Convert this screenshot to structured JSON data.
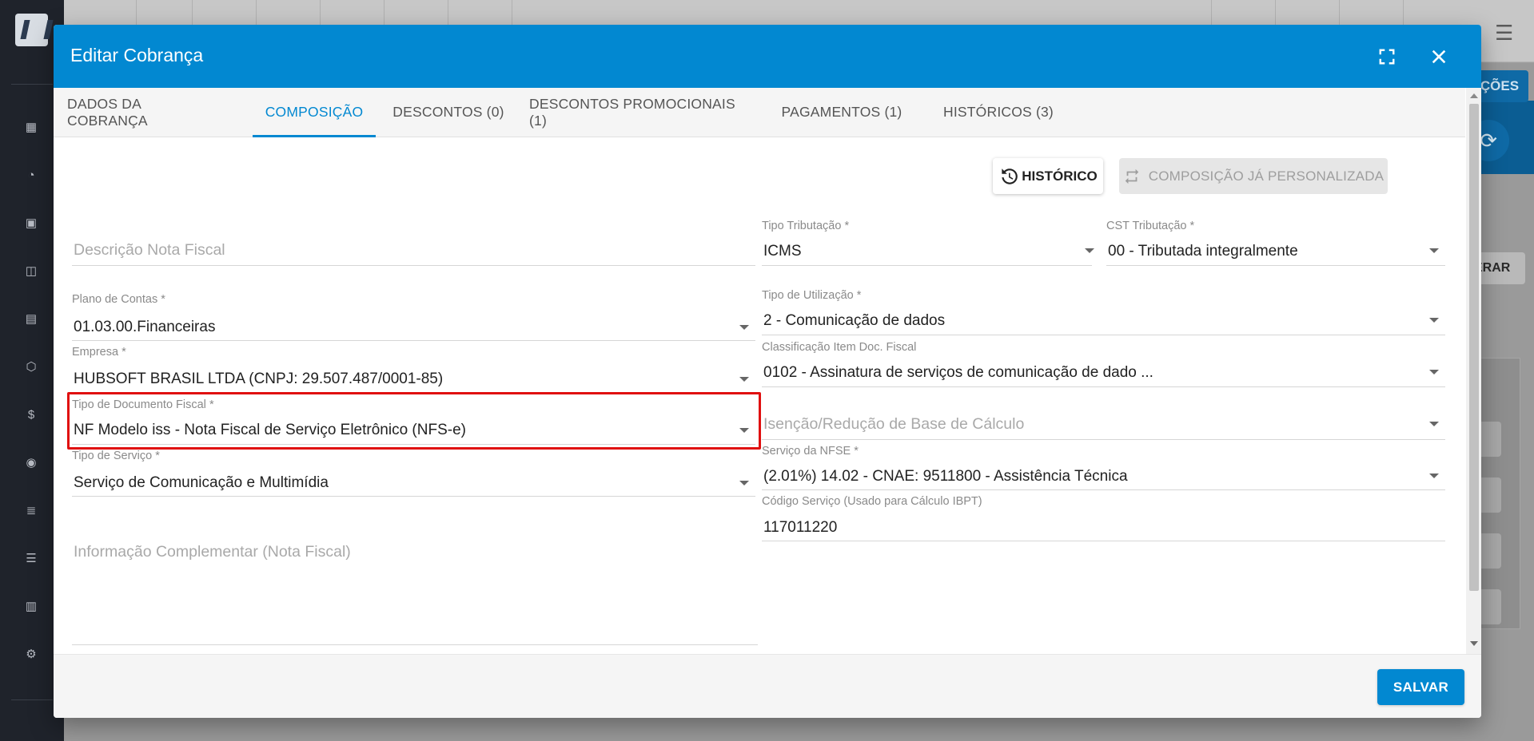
{
  "background": {
    "button_blue_label": "ÇÕES",
    "button_white_label": "ERAR"
  },
  "modal": {
    "title": "Editar Cobrança",
    "header_icons": [
      "fullscreen-icon",
      "close-icon"
    ],
    "tabs": [
      {
        "label": "DADOS DA COBRANÇA"
      },
      {
        "label": "COMPOSIÇÃO",
        "active": true
      },
      {
        "label": "DESCONTOS (0)"
      },
      {
        "label": "DESCONTOS PROMOCIONAIS (1)"
      },
      {
        "label": "PAGAMENTOS (1)"
      },
      {
        "label": "HISTÓRICOS (3)"
      }
    ],
    "actions": {
      "historico_label": "HISTÓRICO",
      "personalizada_label": "COMPOSIÇÃO JÁ PERSONALIZADA"
    },
    "left_fields": {
      "descricao_placeholder": "Descrição Nota Fiscal",
      "plano_label": "Plano de Contas",
      "plano_value": "01.03.00.Financeiras",
      "empresa_label": "Empresa",
      "empresa_value": "HUBSOFT BRASIL LTDA (CNPJ: 29.507.487/0001-85)",
      "tipo_doc_label": "Tipo de Documento Fiscal",
      "tipo_doc_value": "NF Modelo iss - Nota Fiscal de Serviço Eletrônico (NFS-e)",
      "tipo_servico_label": "Tipo de Serviço",
      "tipo_servico_value": "Serviço de Comunicação e Multimídia",
      "info_complementar_placeholder": "Informação Complementar (Nota Fiscal)"
    },
    "right_fields": {
      "tipo_trib_label": "Tipo Tributação",
      "tipo_trib_value": "ICMS",
      "cst_label": "CST Tributação",
      "cst_value": "00 - Tributada integralmente",
      "tipo_util_label": "Tipo de Utilização",
      "tipo_util_value": "2 - Comunicação de dados",
      "classif_label": "Classificação Item Doc. Fiscal",
      "classif_value": "0102 - Assinatura de serviços de comunicação de dado ...",
      "isencao_placeholder": "Isenção/Redução de Base de Cálculo",
      "servico_nfse_label": "Serviço da NFSE",
      "servico_nfse_value": "(2.01%) 14.02 - CNAE: 9511800 - Assistência Técnica",
      "codigo_label": "Código Serviço (Usado para Cálculo IBPT)",
      "codigo_value": "117011220"
    },
    "required_mark": "*",
    "save_label": "SALVAR"
  }
}
